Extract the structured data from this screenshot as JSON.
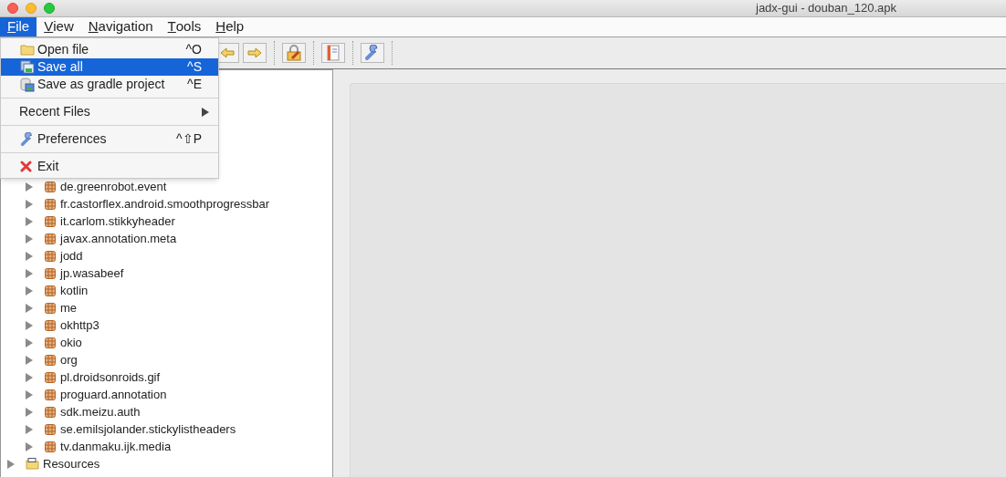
{
  "window": {
    "title": "jadx-gui - douban_120.apk"
  },
  "menubar": [
    {
      "mnemonic": "F",
      "rest": "ile",
      "selected": true
    },
    {
      "mnemonic": "V",
      "rest": "iew",
      "selected": false
    },
    {
      "mnemonic": "N",
      "rest": "avigation",
      "selected": false
    },
    {
      "mnemonic": "T",
      "rest": "ools",
      "selected": false
    },
    {
      "mnemonic": "H",
      "rest": "elp",
      "selected": false
    }
  ],
  "toolbar": [
    {
      "kind": "back"
    },
    {
      "kind": "forward"
    },
    {
      "kind": "separator"
    },
    {
      "kind": "decompile"
    },
    {
      "kind": "separator"
    },
    {
      "kind": "log"
    },
    {
      "kind": "separator"
    },
    {
      "kind": "preferences"
    },
    {
      "kind": "separator"
    }
  ],
  "file_menu": [
    {
      "kind": "item",
      "label": "Open file",
      "shortcut": "^O",
      "selected": false
    },
    {
      "kind": "item",
      "label": "Save all",
      "shortcut": "^S",
      "selected": true
    },
    {
      "kind": "item",
      "label": "Save as gradle project",
      "shortcut": "^E",
      "selected": false
    },
    {
      "kind": "separator"
    },
    {
      "kind": "submenu",
      "label": "Recent Files",
      "selected": false
    },
    {
      "kind": "separator"
    },
    {
      "kind": "item",
      "label": "Preferences",
      "shortcut": "^⇧P",
      "selected": false
    },
    {
      "kind": "separator"
    },
    {
      "kind": "item",
      "label": "Exit",
      "selected": false
    }
  ],
  "tree": {
    "children": [
      {
        "label": "de.greenrobot.event",
        "expanded": false
      },
      {
        "label": "fr.castorflex.android.smoothprogressbar",
        "expanded": false
      },
      {
        "label": "it.carlom.stikkyheader",
        "expanded": false
      },
      {
        "label": "javax.annotation.meta",
        "expanded": false
      },
      {
        "label": "jodd",
        "expanded": false
      },
      {
        "label": "jp.wasabeef",
        "expanded": false
      },
      {
        "label": "kotlin",
        "expanded": false
      },
      {
        "label": "me",
        "expanded": false
      },
      {
        "label": "okhttp3",
        "expanded": false
      },
      {
        "label": "okio",
        "expanded": false
      },
      {
        "label": "org",
        "expanded": false
      },
      {
        "label": "pl.droidsonroids.gif",
        "expanded": false
      },
      {
        "label": "proguard.annotation",
        "expanded": false
      },
      {
        "label": "sdk.meizu.auth",
        "expanded": false
      },
      {
        "label": "se.emilsjolander.stickylistheaders",
        "expanded": false
      },
      {
        "label": "tv.danmaku.ijk.media",
        "expanded": false
      }
    ],
    "root": {
      "label": "Resources",
      "expanded": false
    }
  }
}
